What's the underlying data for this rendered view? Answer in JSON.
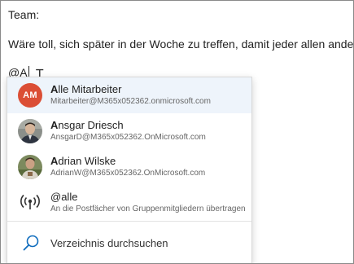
{
  "email": {
    "greeting": "Team:",
    "sentence": "Wäre toll, sich später in der Woche zu treffen, damit jeder allen andere",
    "compose_text": "@A"
  },
  "mention_popup": {
    "accent_color": "#db4e35",
    "selected_bg": "#eef4fb",
    "items": [
      {
        "name_highlight": "A",
        "name_rest": "lle Mitarbeiter",
        "address": "Mitarbeiter@M365x052362.onmicrosoft.com",
        "avatar_initials": "AM"
      },
      {
        "name_highlight": "A",
        "name_rest": "nsgar Driesch",
        "address": "AnsgarD@M365x052362.OnMicrosoft.com",
        "avatar": "person-photo"
      },
      {
        "name_highlight": "A",
        "name_rest": "drian Wilske",
        "address": "AdrianW@M365x052362.OnMicrosoft.com",
        "avatar": "person-photo"
      },
      {
        "name": "@alle",
        "description": "An die Postfächer von Gruppenmitgliedern übertragen",
        "icon": "broadcast-icon"
      }
    ],
    "search": {
      "label": "Verzeichnis durchsuchen",
      "icon": "search-icon"
    }
  }
}
